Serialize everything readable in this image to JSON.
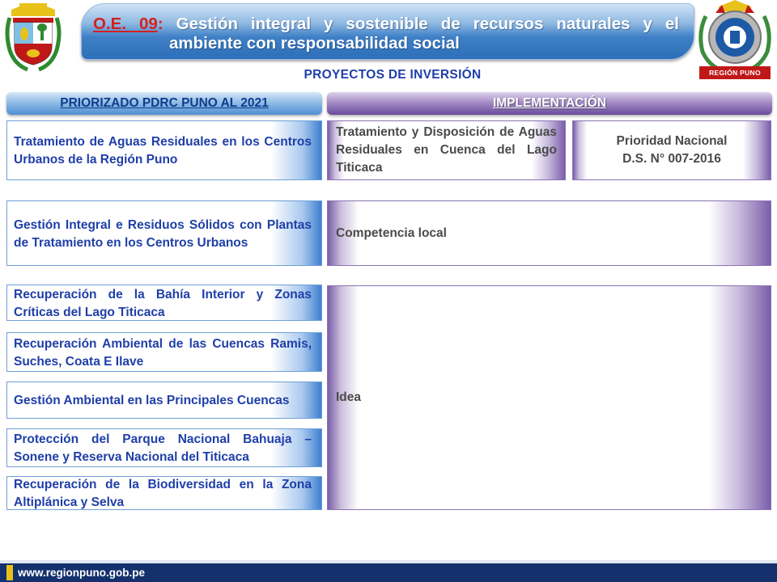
{
  "header": {
    "code": "O.E. 09",
    "colon": ":",
    "title_line1": " Gestión integral y sostenible de recursos naturales y el",
    "title_line2": "ambiente con responsabilidad social"
  },
  "logos": {
    "left": "peru-coat-of-arms",
    "right": "region-puno-seal",
    "right_label": "REGIÓN PUNO"
  },
  "subtitle": "PROYECTOS DE INVERSIÓN",
  "columns": {
    "left_header": "PRIORIZADO  PDRC PUNO AL 2021",
    "right_header": "IMPLEMENTACIÓN"
  },
  "projects": [
    "Tratamiento de Aguas Residuales en los Centros Urbanos de la Región Puno",
    "Gestión Integral e Residuos Sólidos con Plantas de Tratamiento en los Centros Urbanos",
    "Recuperación de la Bahía Interior y Zonas Críticas del Lago Titicaca",
    "Recuperación Ambiental de las Cuencas Ramis, Suches, Coata E Ilave",
    "Gestión Ambiental en las Principales Cuencas",
    "Protección del Parque Nacional Bahuaja – Sonene y Reserva Nacional del Titicaca",
    "Recuperación de la Biodiversidad en la Zona Altiplánica y Selva"
  ],
  "implementation": {
    "row1_left": "Tratamiento y Disposición de Aguas Residuales en Cuenca del Lago Titicaca",
    "row1_right_line1": "Prioridad Nacional",
    "row1_right_line2": "D.S. N° 007-2016",
    "row2": "Competencia local",
    "row3": "Idea"
  },
  "footer": {
    "url": "www.regionpuno.gob.pe"
  },
  "colors": {
    "title_blue": "#1f3fa8",
    "code_red": "#d42020",
    "footer_navy": "#14316d",
    "purple": "#6a4c9a"
  }
}
